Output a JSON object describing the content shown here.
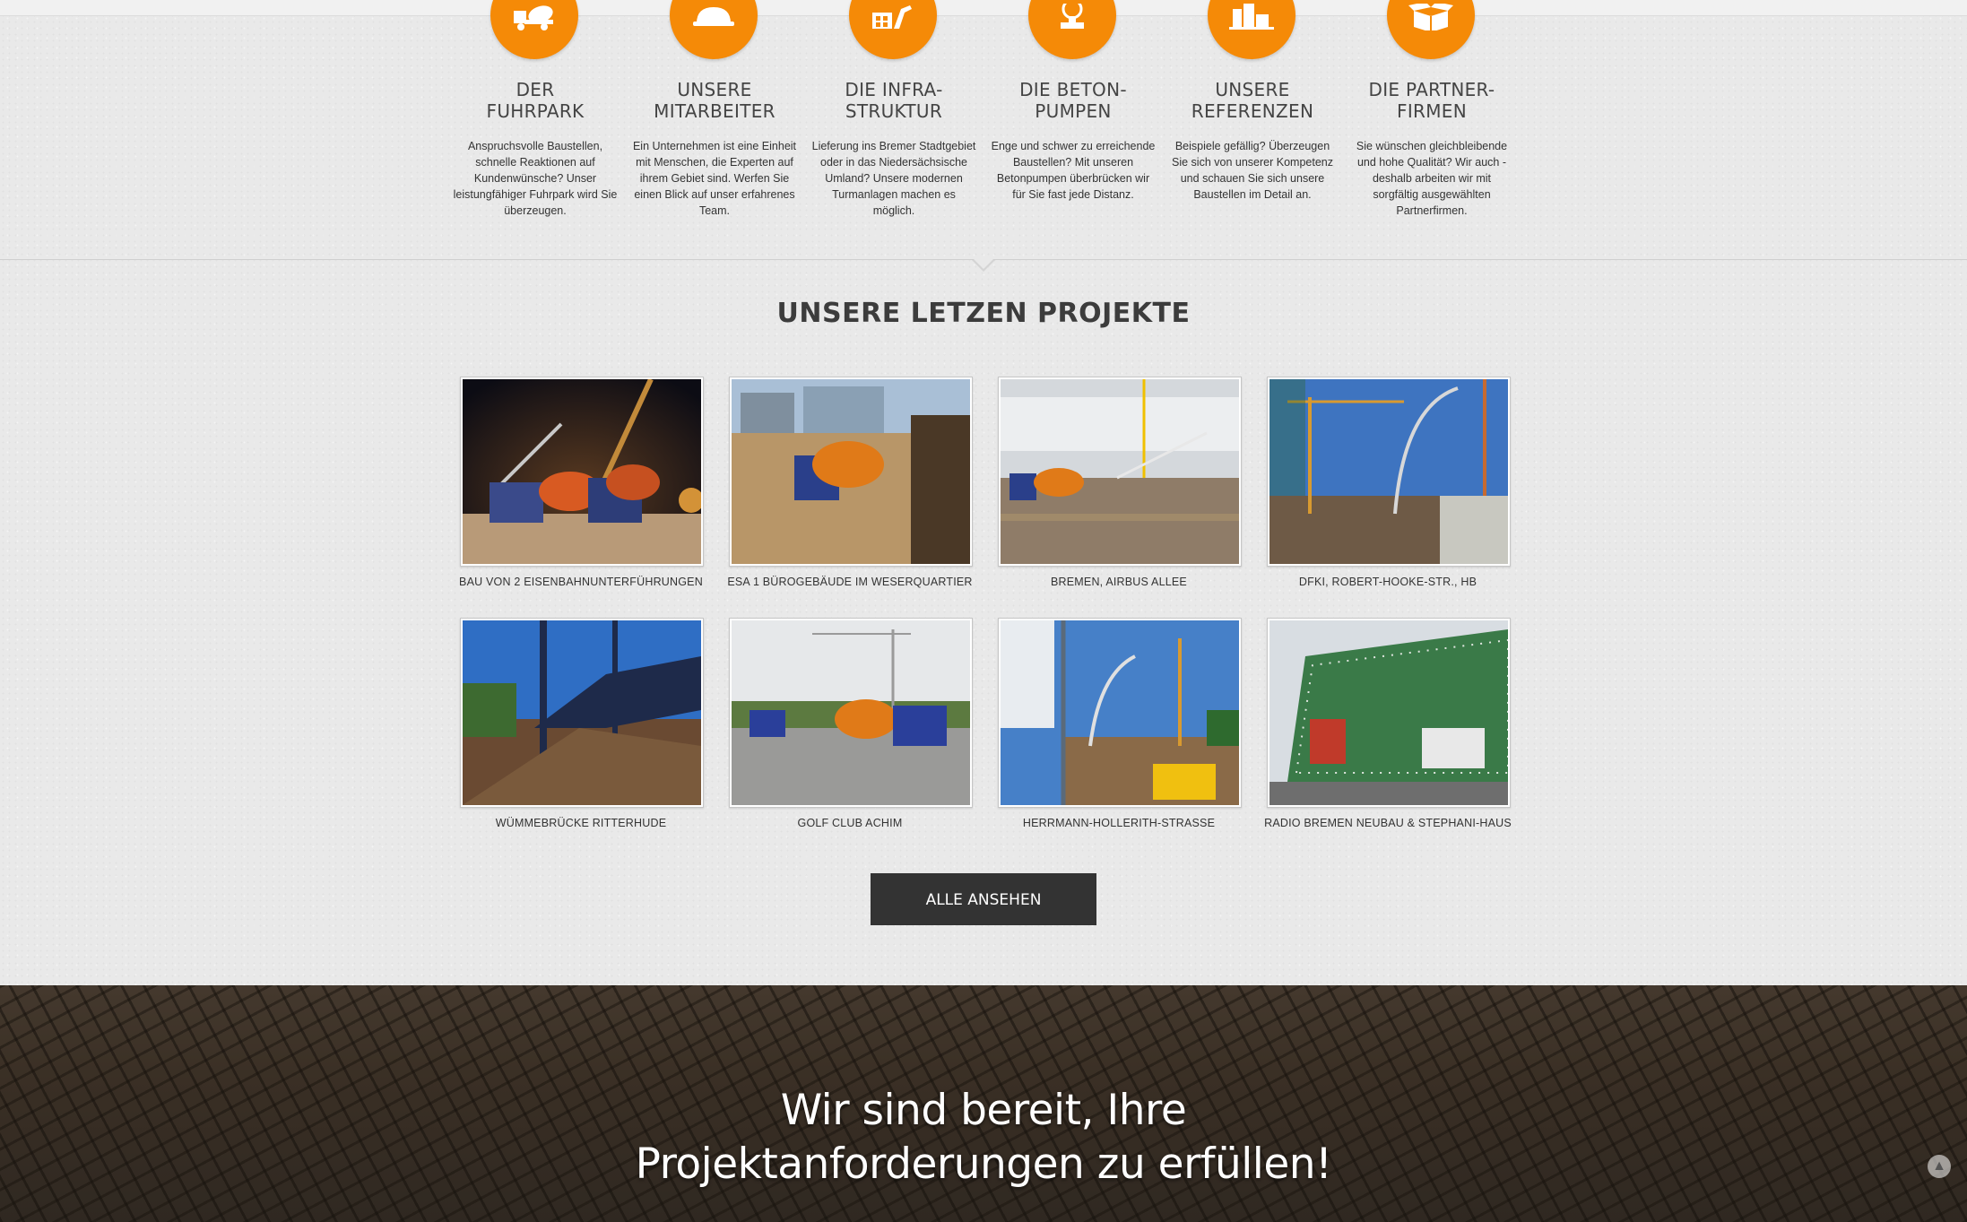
{
  "colors": {
    "accent": "#f58a07",
    "button_bg": "#333333",
    "page_bg": "#e9e9e9"
  },
  "services": [
    {
      "icon": "mixer-truck-icon",
      "title_line1": "DER",
      "title_line2": "FUHRPARK",
      "description": "Anspruchsvolle Baustellen, schnelle Reaktionen auf Kundenwünsche? Unser leistungfähiger Fuhrpark wird Sie überzeugen."
    },
    {
      "icon": "hard-hat-icon",
      "title_line1": "UNSERE",
      "title_line2": "MITARBEITER",
      "description": "Ein Unternehmen ist eine Einheit mit Menschen, die Experten auf ihrem Gebiet sind. Werfen Sie einen Blick auf unser erfahrenes Team."
    },
    {
      "icon": "infrastructure-icon",
      "title_line1": "DIE INFRA-",
      "title_line2": "STRUKTUR",
      "description": "Lieferung ins Bremer Stadtgebiet oder in das Niedersächsische Umland? Unsere modernen Turmanlagen machen es möglich."
    },
    {
      "icon": "pump-gauge-icon",
      "title_line1": "DIE BETON-",
      "title_line2": "PUMPEN",
      "description": "Enge und schwer zu erreichende Baustellen? Mit unseren Betonpumpen überbrücken wir für Sie fast jede Distanz."
    },
    {
      "icon": "city-buildings-icon",
      "title_line1": "UNSERE",
      "title_line2": "REFERENZEN",
      "description": "Beispiele gefällig? Überzeugen Sie sich von unserer Kompetenz und schauen Sie sich unsere Baustellen im Detail an."
    },
    {
      "icon": "open-box-icon",
      "title_line1": "DIE PARTNER-",
      "title_line2": "FIRMEN",
      "description": "Sie wünschen gleichbleibende und hohe Qualität? Wir auch - deshalb arbeiten wir mit sorgfältig ausgewählten Partnerfirmen."
    }
  ],
  "projects_heading": "UNSERE LETZEN PROJEKTE",
  "projects": [
    {
      "caption": "BAU VON 2 EISENBAHNUNTERFÜHRUNGEN"
    },
    {
      "caption": "ESA 1 BÜROGEBÄUDE IM WESERQUARTIER"
    },
    {
      "caption": "BREMEN, AIRBUS ALLEE"
    },
    {
      "caption": "DFKI, ROBERT-HOOKE-STR., HB"
    },
    {
      "caption": "WÜMMEBRÜCKE RITTERHUDE"
    },
    {
      "caption": "GOLF CLUB ACHIM"
    },
    {
      "caption": "HERRMANN-HOLLERITH-STRASSE"
    },
    {
      "caption": "RADIO BREMEN NEUBAU & STEPHANI-HAUS"
    }
  ],
  "view_all_label": "ALLE ANSEHEN",
  "banner": {
    "line1": "Wir sind bereit, Ihre",
    "line2": "Projektanforderungen zu erfüllen!"
  }
}
